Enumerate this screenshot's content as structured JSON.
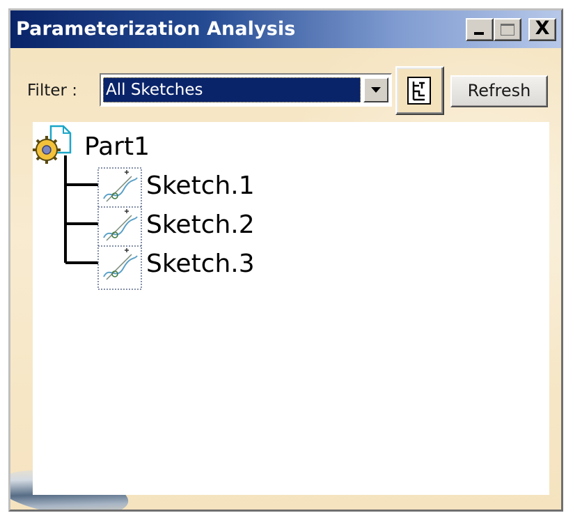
{
  "window": {
    "title": "Parameterization Analysis",
    "controls": {
      "minimize_icon": "minimize-icon",
      "maximize_icon": "maximize-icon",
      "close_icon": "close-icon",
      "close_glyph": "X"
    }
  },
  "toolbar": {
    "filter_label": "Filter :",
    "filter_value": "All Sketches",
    "tree_view_icon": "tree-view-icon",
    "refresh_label": "Refresh"
  },
  "tree": {
    "root": {
      "label": "Part1",
      "icon": "part-icon"
    },
    "children": [
      {
        "label": "Sketch.1",
        "icon": "sketch-icon"
      },
      {
        "label": "Sketch.2",
        "icon": "sketch-icon"
      },
      {
        "label": "Sketch.3",
        "icon": "sketch-icon"
      }
    ]
  },
  "colors": {
    "titlebar_start": "#0a246a",
    "titlebar_end": "#b7c8e9",
    "selection": "#0a246a",
    "window_bg": "#f5e6c6"
  }
}
